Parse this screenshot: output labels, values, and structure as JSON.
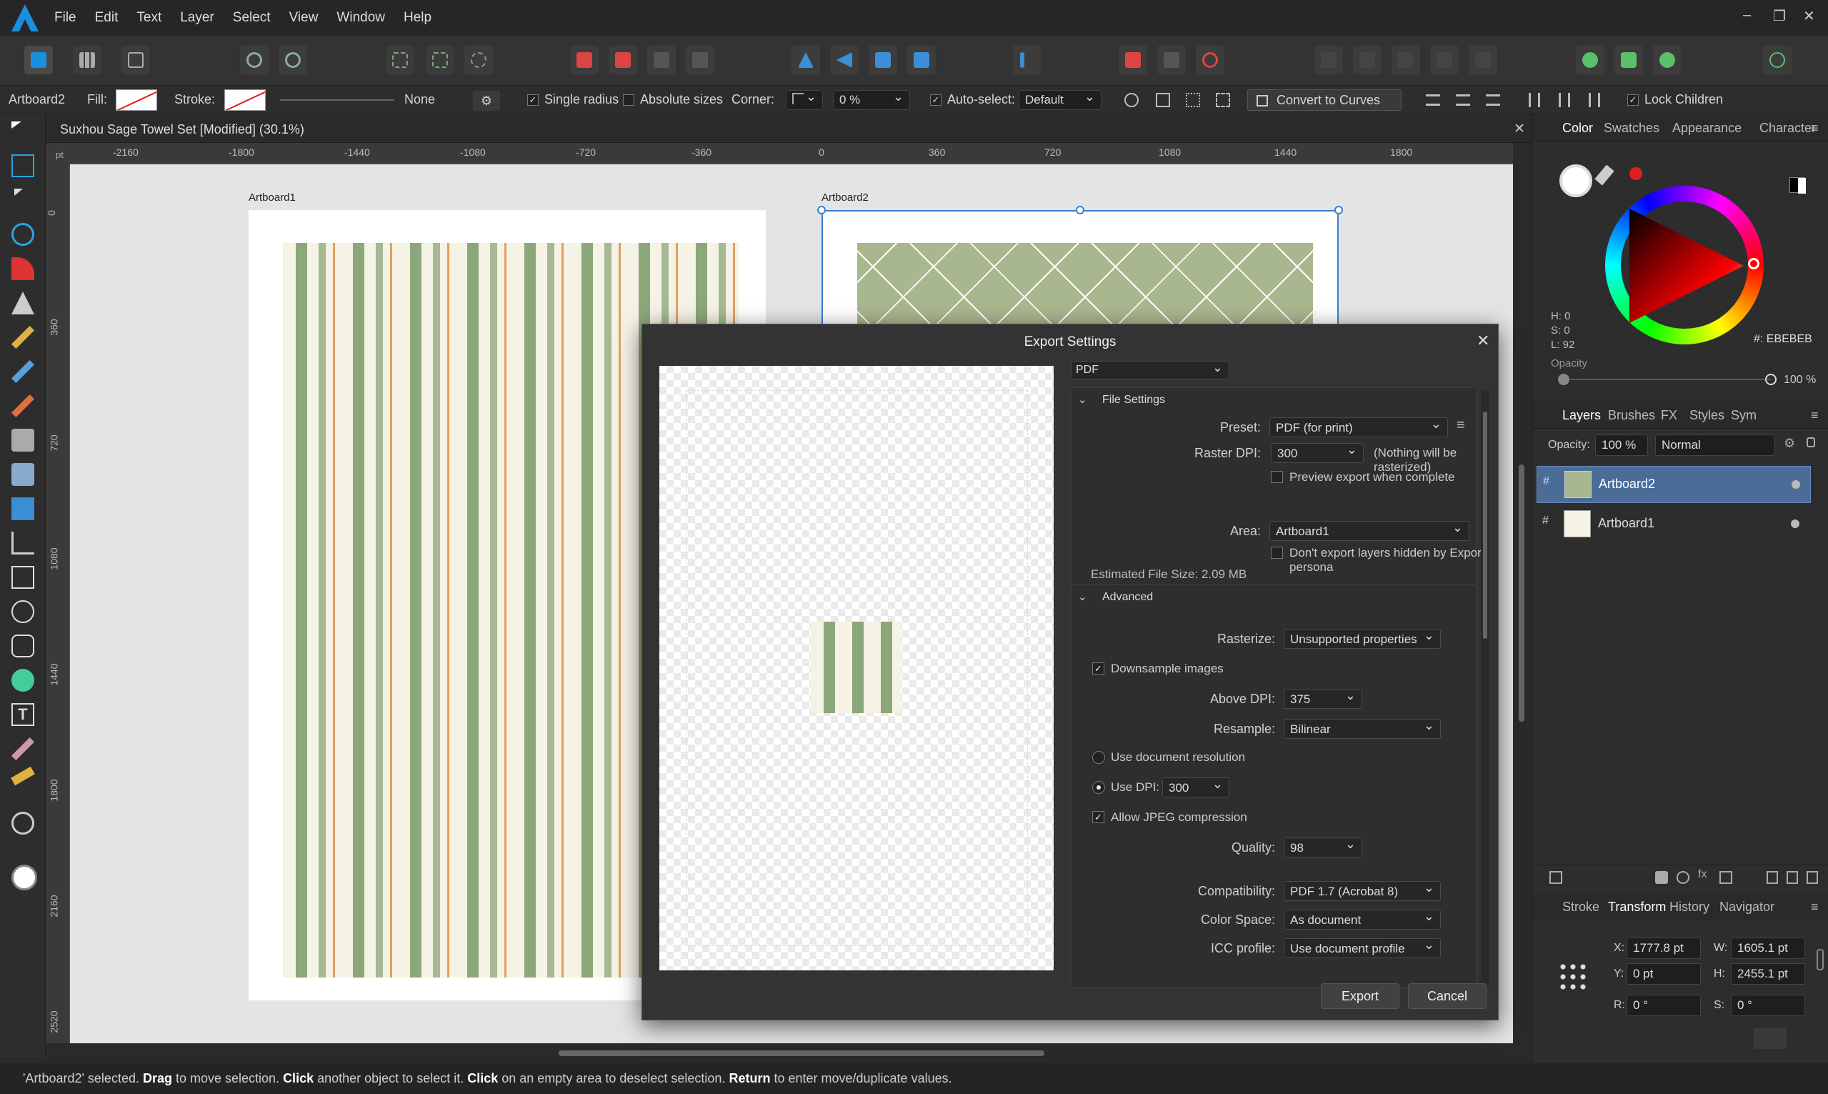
{
  "menu": {
    "items": [
      "File",
      "Edit",
      "Text",
      "Layer",
      "Select",
      "View",
      "Window",
      "Help"
    ]
  },
  "context": {
    "object": "Artboard2",
    "fill_label": "Fill:",
    "stroke_label": "Stroke:",
    "stroke_width": "None",
    "single_radius": "Single radius",
    "absolute_sizes": "Absolute sizes",
    "corner_label": "Corner:",
    "corner_value": "0 %",
    "auto_select": "Auto-select:",
    "auto_select_value": "Default",
    "convert": "Convert to Curves",
    "lock_children": "Lock Children"
  },
  "document": {
    "title": "Suxhou Sage Towel Set [Modified] (30.1%)",
    "ruler_unit": "pt",
    "h_ticks": [
      "-2160",
      "-1800",
      "-1440",
      "-1080",
      "-720",
      "-360",
      "0",
      "360",
      "720",
      "1080",
      "1440",
      "1800"
    ],
    "v_ticks": [
      "0",
      "360",
      "720",
      "1080",
      "1440",
      "1800",
      "2160",
      "2520"
    ],
    "artboard1": "Artboard1",
    "artboard2": "Artboard2"
  },
  "dialog": {
    "title": "Export Settings",
    "format": "PDF",
    "file_settings": "File Settings",
    "preset_label": "Preset:",
    "preset": "PDF (for print)",
    "raster_dpi_label": "Raster DPI:",
    "raster_dpi": "300",
    "raster_note": "(Nothing will be rasterized)",
    "preview_export": "Preview export when complete",
    "area_label": "Area:",
    "area": "Artboard1",
    "dont_export_hidden": "Don't export layers hidden by Export persona",
    "estimated": "Estimated File Size: 2.09 MB",
    "advanced": "Advanced",
    "rasterize_label": "Rasterize:",
    "rasterize": "Unsupported properties",
    "downsample": "Downsample images",
    "above_dpi_label": "Above DPI:",
    "above_dpi": "375",
    "resample_label": "Resample:",
    "resample": "Bilinear",
    "use_doc_res": "Use document resolution",
    "use_dpi_label": "Use DPI:",
    "use_dpi": "300",
    "allow_jpeg": "Allow JPEG compression",
    "quality_label": "Quality:",
    "quality": "98",
    "compat_label": "Compatibility:",
    "compat": "PDF 1.7 (Acrobat 8)",
    "color_space_label": "Color Space:",
    "color_space": "As document",
    "icc_label": "ICC profile:",
    "icc": "Use document profile",
    "export": "Export",
    "cancel": "Cancel"
  },
  "color_panel": {
    "tabs": [
      "Color",
      "Swatches",
      "Appearance",
      "Character"
    ],
    "h": "H: 0",
    "s": "S: 0",
    "l": "L: 92",
    "hex": "#: EBEBEB",
    "opacity_label": "Opacity",
    "opacity": "100 %"
  },
  "layers_panel": {
    "tabs": [
      "Layers",
      "Brushes",
      "FX",
      "Styles",
      "Sym"
    ],
    "opacity_label": "Opacity:",
    "opacity": "100 %",
    "blend": "Normal",
    "layers": [
      "Artboard2",
      "Artboard1"
    ]
  },
  "transform_panel": {
    "tabs": [
      "Stroke",
      "Transform",
      "History",
      "Navigator"
    ],
    "x_label": "X:",
    "x": "1777.8 pt",
    "w_label": "W:",
    "w": "1605.1 pt",
    "y_label": "Y:",
    "y": "0 pt",
    "h_label": "H:",
    "h": "2455.1 pt",
    "r_label": "R:",
    "r": "0 °",
    "s_label": "S:",
    "s": "0 °"
  },
  "status": {
    "p1": "'Artboard2' selected. ",
    "b1": "Drag",
    "p2": " to move selection. ",
    "b2": "Click",
    "p3": " another object to select it. ",
    "b3": "Click",
    "p4": " on an empty area to deselect selection. ",
    "b4": "Return",
    "p5": " to enter move/duplicate values."
  },
  "colors": {
    "accent": "#1a8fe0",
    "sage": "#8ca77a",
    "orange": "#e3a05a",
    "selection": "#4a6c97"
  }
}
